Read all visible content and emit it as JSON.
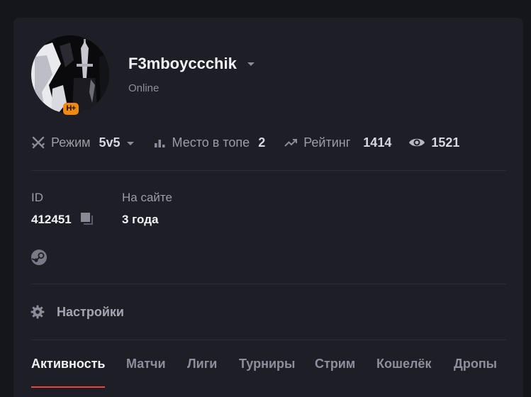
{
  "profile": {
    "username": "F3mboyccchik",
    "status": "Online",
    "badge": "H+"
  },
  "stats": {
    "mode_label": "Режим",
    "mode_value": "5v5",
    "rank_label": "Место в топе",
    "rank_value": "2",
    "rating_label": "Рейтинг",
    "rating_value": "1414",
    "views_value": "1521"
  },
  "info": {
    "id_label": "ID",
    "id_value": "412451",
    "onsite_label": "На сайте",
    "onsite_value": "3 года"
  },
  "settings": {
    "label": "Настройки"
  },
  "tabs": [
    {
      "label": "Активность"
    },
    {
      "label": "Матчи"
    },
    {
      "label": "Лиги"
    },
    {
      "label": "Турниры"
    },
    {
      "label": "Стрим"
    },
    {
      "label": "Кошелёк"
    },
    {
      "label": "Дропы"
    }
  ],
  "active_tab": "Активность",
  "colors": {
    "background": "#15151c",
    "card": "#1e1e27",
    "accent_underline": "#e3463c",
    "badge": "#f0890f",
    "muted_text": "#9c9ca8"
  },
  "icons": [
    "crossed-swords-icon",
    "bar-chart-icon",
    "trending-up-icon",
    "eye-icon",
    "copy-icon",
    "steam-icon",
    "gear-icon",
    "chevron-down-icon"
  ]
}
